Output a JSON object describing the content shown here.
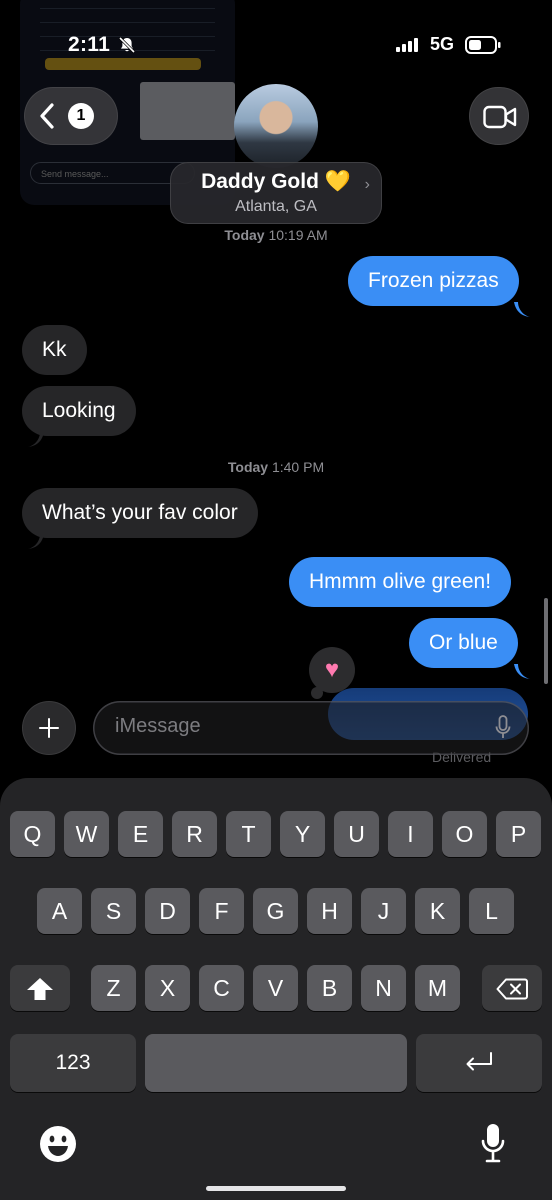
{
  "status": {
    "time": "2:11",
    "network": "5G"
  },
  "nav": {
    "back_badge": "1"
  },
  "contact": {
    "name": "Daddy Gold 💛",
    "location": "Atlanta, GA"
  },
  "background_screenshot": {
    "note_text": "...w a free 80k\n...ground would\n...k it up?!?!",
    "send_placeholder": "Send message..."
  },
  "messages": [
    {
      "type": "timestamp",
      "day": "Today",
      "time": "10:19 AM"
    },
    {
      "type": "out",
      "text": "Frozen pizzas"
    },
    {
      "type": "in",
      "text": "Kk"
    },
    {
      "type": "in",
      "text": "Looking"
    },
    {
      "type": "timestamp",
      "day": "Today",
      "time": "1:40 PM"
    },
    {
      "type": "in",
      "text": "What’s your fav color"
    },
    {
      "type": "out",
      "text": "Hmmm olive green!"
    },
    {
      "type": "out",
      "text": "Or blue"
    }
  ],
  "tapback": {
    "icon": "heart-icon",
    "glyph": "♥"
  },
  "delivered_label": "Delivered",
  "compose": {
    "placeholder": "iMessage"
  },
  "keyboard": {
    "row1": [
      "Q",
      "W",
      "E",
      "R",
      "T",
      "Y",
      "U",
      "I",
      "O",
      "P"
    ],
    "row2": [
      "A",
      "S",
      "D",
      "F",
      "G",
      "H",
      "J",
      "K",
      "L"
    ],
    "row3": [
      "Z",
      "X",
      "C",
      "V",
      "B",
      "N",
      "M"
    ],
    "numbers_label": "123"
  },
  "colors": {
    "outgoing": "#3a8ef5",
    "incoming": "#262628",
    "keyboard_bg": "#242426",
    "key": "#5a5a5e"
  }
}
